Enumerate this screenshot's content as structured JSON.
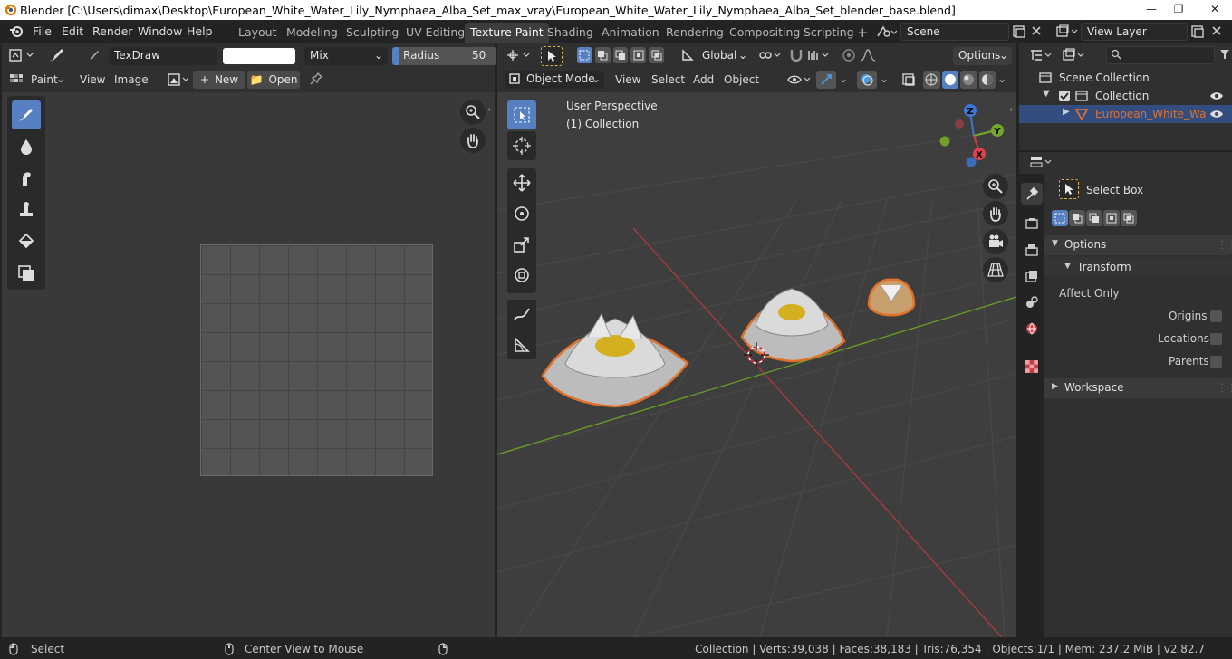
{
  "window": {
    "title": "Blender [C:\\Users\\dimax\\Desktop\\European_White_Water_Lily_Nymphaea_Alba_Set_max_vray\\European_White_Water_Lily_Nymphaea_Alba_Set_blender_base.blend]"
  },
  "menubar": {
    "items": [
      "File",
      "Edit",
      "Render",
      "Window",
      "Help"
    ],
    "tabs": [
      "Layout",
      "Modeling",
      "Sculpting",
      "UV Editing",
      "Texture Paint",
      "Shading",
      "Animation",
      "Rendering",
      "Compositing",
      "Scripting"
    ],
    "active_tab": "Texture Paint",
    "add_tab": "+",
    "scene": "Scene",
    "view_layer": "View Layer"
  },
  "image_editor": {
    "brush_name": "TexDraw",
    "blend_mode": "Mix",
    "radius_label": "Radius",
    "radius_value": "50 px",
    "mode_label": "Paint",
    "menu_view": "View",
    "menu_image": "Image",
    "new_label": "New",
    "open_label": "Open",
    "brush_color": "#ffffff",
    "tools": [
      "draw-brush",
      "soften-brush",
      "smear-brush",
      "clone-brush",
      "fill-brush",
      "mask-brush"
    ]
  },
  "viewport": {
    "transform_orientation": "Global",
    "options_label": "Options",
    "mode": "Object Mode",
    "menu": [
      "View",
      "Select",
      "Add",
      "Object"
    ],
    "overlay_line1": "User Perspective",
    "overlay_line2": "(1) Collection",
    "gizmo_z": "Z",
    "gizmo_y": "Y",
    "gizmo_x": "X"
  },
  "outliner": {
    "scene_collection": "Scene Collection",
    "collection": "Collection",
    "object": "European_White_Water_L"
  },
  "properties": {
    "tool_name": "Select Box",
    "options_section": "Options",
    "transform_section": "Transform",
    "affect_only": "Affect Only",
    "origins": "Origins",
    "locations": "Locations",
    "parents": "Parents",
    "workspace_section": "Workspace"
  },
  "statusbar": {
    "select": "Select",
    "center_view": "Center View to Mouse",
    "stats": "Collection | Verts:39,038 | Faces:38,183 | Tris:76,354 | Objects:1/1 | Mem: 237.2 MiB | v2.82.7"
  },
  "colors": {
    "accent": "#5680c2",
    "selected_object": "#e0702a",
    "x_axis": "#c2404a",
    "y_axis": "#78a82a",
    "z_axis": "#3c78d8"
  }
}
